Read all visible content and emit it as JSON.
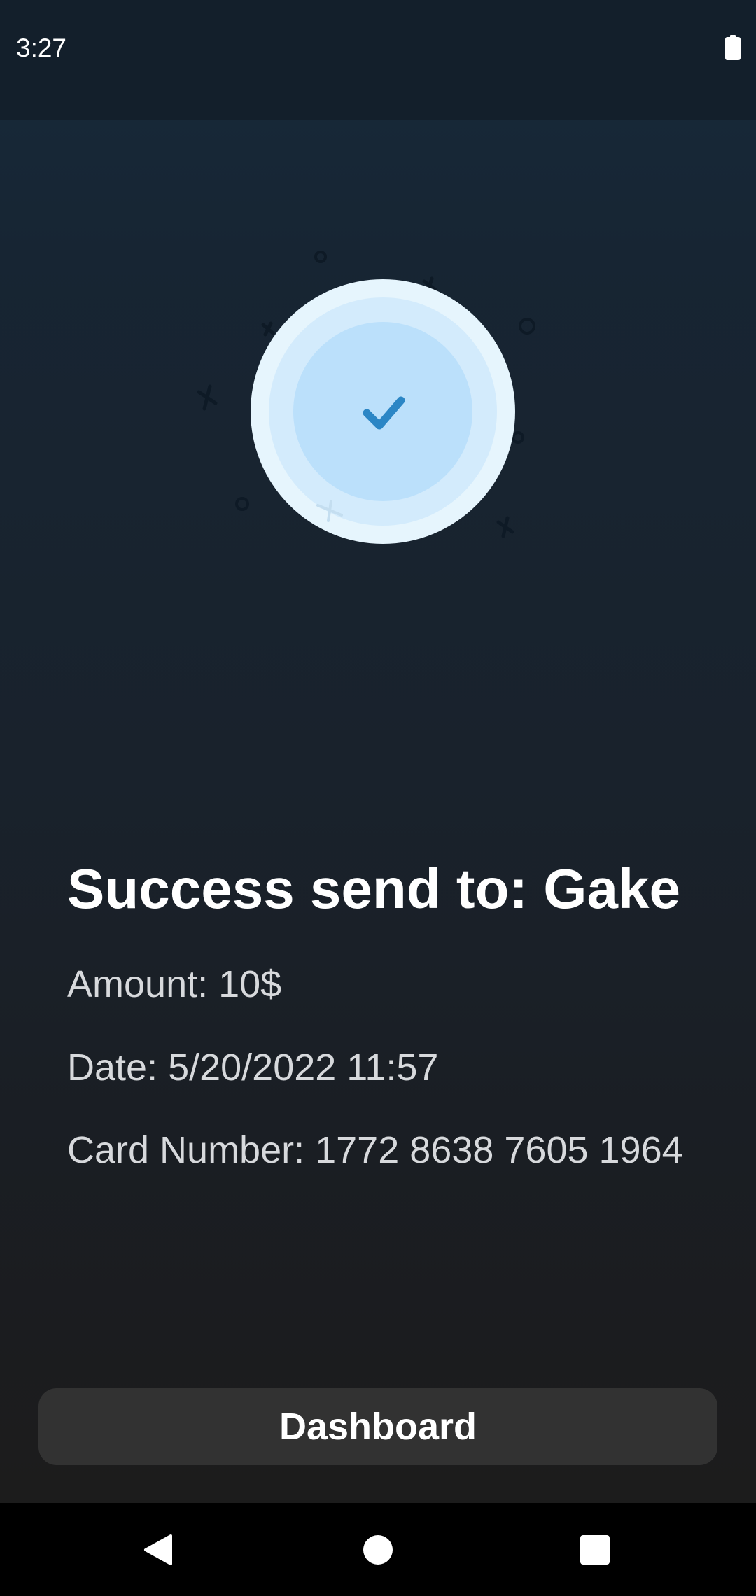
{
  "status_bar": {
    "time": "3:27",
    "battery_icon": "battery-full-icon"
  },
  "illustration": {
    "icon": "checkmark-icon",
    "colors": {
      "outer_ring": "#e6f5fd",
      "middle_ring": "#d3ebfc",
      "inner_circle": "#bbe0fb",
      "check": "#2b86c5"
    }
  },
  "transaction": {
    "title": "Success send to: Gake",
    "amount": "Amount: 10$",
    "date": "Date: 5/20/2022 11:57",
    "card_number": "Card Number: 1772 8638 7605 1964"
  },
  "actions": {
    "dashboard_label": "Dashboard"
  },
  "navigation_bar": {
    "back_icon": "back-triangle-icon",
    "home_icon": "home-circle-icon",
    "recents_icon": "recents-square-icon"
  }
}
